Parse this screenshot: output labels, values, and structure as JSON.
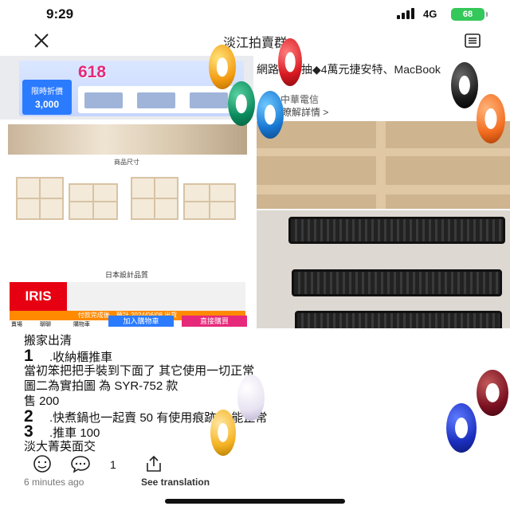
{
  "status_bar": {
    "time": "9:29",
    "network": "4G",
    "battery": "68"
  },
  "header": {
    "title": "淡江拍賣群"
  },
  "post_preview": {
    "title": "網路申請抽◆4萬元捷安特、MacBook",
    "org": "中華電信",
    "link": "瞭解詳情 >"
  },
  "ad": {
    "badge": "618",
    "coupon_label": "限時折價",
    "coupon_value": "3,000"
  },
  "product_sheet": {
    "size_label": "商品尺寸",
    "japan_label": "日本設計品質",
    "brand": "IRIS",
    "date_bar": "付款完成後，預計 2024/06/08 出貨",
    "add_to_cart": "加入購物車",
    "buy_now": "直接購買",
    "nav_shop": "賣場",
    "nav_chat": "聊聊",
    "nav_cart": "購物車"
  },
  "description": {
    "line1": "搬家出清",
    "item1_num": "1",
    "item1_text": ".收納櫃推車",
    "line3": "當初笨把把手裝到下面了 其它使用一切正常",
    "line4": "圖二為實拍圖 為 SYR-752 款",
    "line5": "售 200",
    "item2_num": "2",
    "item2_text": ".快煮鍋也一起賣 50 有使用痕跡 功能正常",
    "item3_num": "3",
    "item3_text": ".推車 100",
    "line8": "淡大菁英面交"
  },
  "actions": {
    "like_count": "1",
    "timestamp": "6 minutes ago",
    "translate": "See translation"
  },
  "colors": {
    "orange": "#ff8a00",
    "blue": "#2b7bff",
    "pink": "#e6297a",
    "battery": "#34c759"
  },
  "icons": [
    "close-icon",
    "menu-icon",
    "emoji-icon",
    "comment-icon",
    "share-icon"
  ]
}
